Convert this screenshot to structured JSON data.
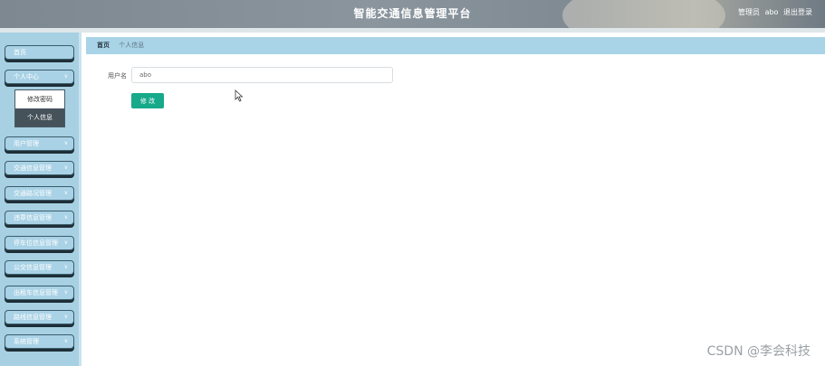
{
  "header": {
    "title": "智能交通信息管理平台",
    "role": "管理员",
    "username": "abo",
    "logout": "退出登录"
  },
  "sidebar": {
    "items": [
      {
        "label": "首页",
        "has_chevron": false
      },
      {
        "label": "个人中心",
        "has_chevron": true,
        "expanded": true,
        "children": [
          {
            "label": "修改密码",
            "active": false
          },
          {
            "label": "个人信息",
            "active": true
          }
        ]
      },
      {
        "label": "用户管理",
        "has_chevron": true
      },
      {
        "label": "交通信息管理",
        "has_chevron": true
      },
      {
        "label": "交通路况管理",
        "has_chevron": true
      },
      {
        "label": "违章信息管理",
        "has_chevron": true
      },
      {
        "label": "停车位信息管理",
        "has_chevron": true
      },
      {
        "label": "公交信息管理",
        "has_chevron": true
      },
      {
        "label": "出租车信息管理",
        "has_chevron": true
      },
      {
        "label": "路线信息管理",
        "has_chevron": true
      },
      {
        "label": "系统管理",
        "has_chevron": true
      }
    ]
  },
  "breadcrumb": {
    "home": "首页",
    "current": "个人信息"
  },
  "form": {
    "username_label": "用户名",
    "username_value": "abo",
    "save_label": "修 改"
  },
  "watermark": "CSDN @李会科技",
  "colors": {
    "sidebar_bg": "#a7d0e3",
    "breadcrumb_bg": "#a9d4e7",
    "save_button": "#16a98a",
    "active_submenu": "#45525a"
  }
}
